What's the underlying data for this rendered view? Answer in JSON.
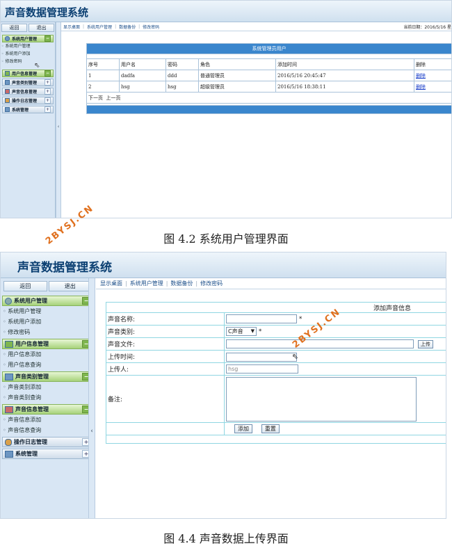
{
  "screen1": {
    "app_title": "声音数据管理系统",
    "buttons": {
      "back": "返回",
      "exit": "退出"
    },
    "groups": [
      {
        "label": "系统用户管理",
        "items": [
          "系统用户管理",
          "系统用户添加",
          "修改密码"
        ]
      },
      {
        "label": "用户信息管理"
      },
      {
        "label": "声音类别管理"
      },
      {
        "label": "声音信息管理"
      },
      {
        "label": "操作日志管理"
      },
      {
        "label": "系统管理"
      }
    ],
    "nav": [
      "显示桌面",
      "系统用户管理",
      "数据备份",
      "修改密码"
    ],
    "date_label": "当前日期：2016/5/16 星",
    "table": {
      "title": "系统管理员用户",
      "columns": [
        "序号",
        "用户名",
        "密码",
        "角色",
        "添加时间",
        "删除"
      ],
      "rows": [
        [
          "1",
          "dadfa",
          "ddd",
          "普通管理员",
          "2016/5/16 20:45:47",
          "删除"
        ],
        [
          "2",
          "hsg",
          "hsg",
          "超级管理员",
          "2016/5/16 18:38:11",
          "删除"
        ]
      ],
      "pager": "下一页  上一页"
    }
  },
  "caption1": "图 4.2 系统用户管理界面",
  "screen2": {
    "app_title": "声音数据管理系统",
    "buttons": {
      "back": "返回",
      "exit": "退出"
    },
    "groups": [
      {
        "label": "系统用户管理",
        "items": [
          "系统用户管理",
          "系统用户添加",
          "修改密码"
        ]
      },
      {
        "label": "用户信息管理",
        "items": [
          "用户信息添加",
          "用户信息查询"
        ]
      },
      {
        "label": "声音类别管理",
        "items": [
          "声音类别添加",
          "声音类别查询"
        ]
      },
      {
        "label": "声音信息管理",
        "items": [
          "声音信息添加",
          "声音信息查询"
        ]
      },
      {
        "label": "操作日志管理"
      },
      {
        "label": "系统管理"
      }
    ],
    "nav": [
      "显示桌面",
      "系统用户管理",
      "数据备份",
      "修改密码"
    ],
    "form": {
      "title": "添加声音信息",
      "labels": {
        "name": "声音名称:",
        "category": "声音类别:",
        "file": "声音文件:",
        "time": "上传时间:",
        "uploader": "上传人:",
        "remark": "备注:"
      },
      "name_value": "",
      "category_value": "C声音",
      "file_value": "",
      "time_value": "",
      "uploader_value": "hsg",
      "remark_value": "",
      "required_mark": "*",
      "upload_button": "上传",
      "add_button": "添加",
      "reset_button": "重置"
    }
  },
  "caption2": "图 4.4 声音数据上传界面",
  "watermark": "2BYSJ.CN",
  "colors": {
    "accent": "#3a86cd",
    "title": "#0b3f72",
    "group_open": "#a7d27a",
    "watermark": "#e0701e"
  }
}
